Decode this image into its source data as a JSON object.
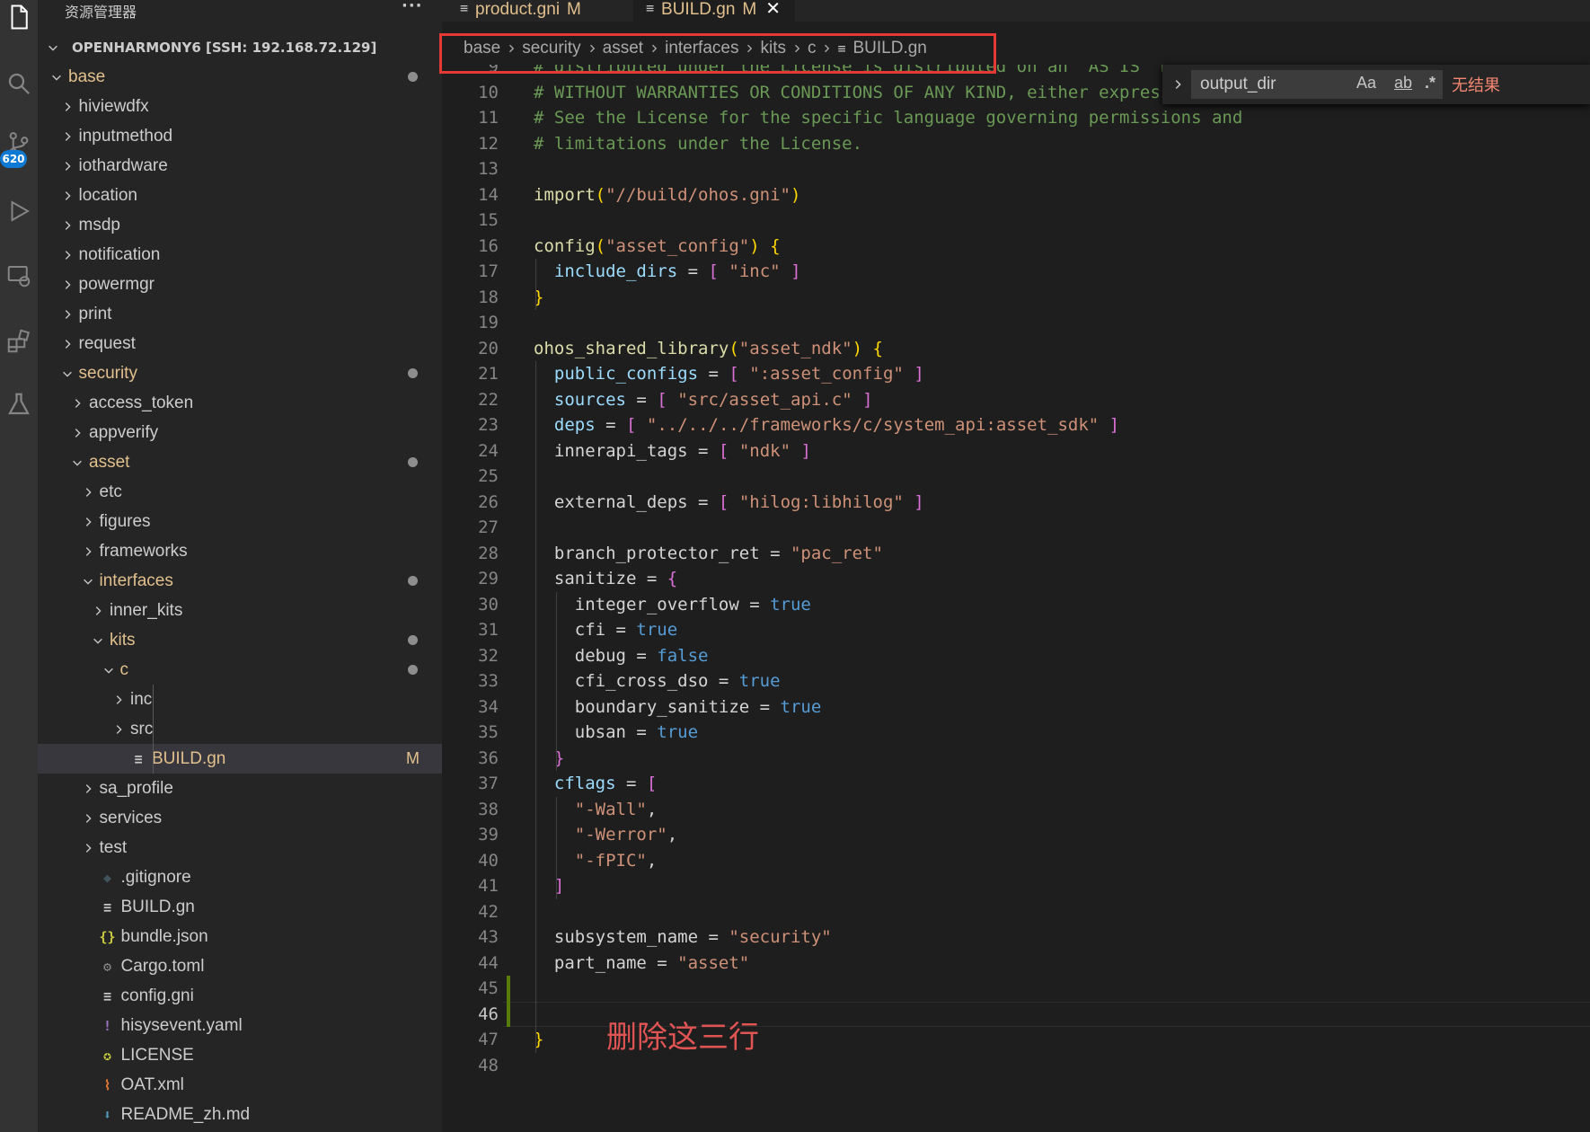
{
  "activity_bar": {
    "items": [
      {
        "name": "explorer-icon",
        "active": true
      },
      {
        "name": "search-icon"
      },
      {
        "name": "source-control-icon",
        "badge": "620"
      },
      {
        "name": "run-debug-icon"
      },
      {
        "name": "remote-explorer-icon"
      },
      {
        "name": "extensions-icon"
      },
      {
        "name": "testing-icon"
      }
    ]
  },
  "sidebar": {
    "title": "资源管理器",
    "more": "···",
    "root": "OPENHARMONY6 [SSH: 192.168.72.129]",
    "tree": [
      {
        "label": "base",
        "level": 0,
        "expanded": true,
        "modified": true,
        "dot": true
      },
      {
        "label": "hiviewdfx",
        "level": 1,
        "folder": true
      },
      {
        "label": "inputmethod",
        "level": 1,
        "folder": true
      },
      {
        "label": "iothardware",
        "level": 1,
        "folder": true
      },
      {
        "label": "location",
        "level": 1,
        "folder": true
      },
      {
        "label": "msdp",
        "level": 1,
        "folder": true
      },
      {
        "label": "notification",
        "level": 1,
        "folder": true
      },
      {
        "label": "powermgr",
        "level": 1,
        "folder": true
      },
      {
        "label": "print",
        "level": 1,
        "folder": true
      },
      {
        "label": "request",
        "level": 1,
        "folder": true
      },
      {
        "label": "security",
        "level": 1,
        "expanded": true,
        "modified": true,
        "dot": true
      },
      {
        "label": "access_token",
        "level": 2,
        "folder": true
      },
      {
        "label": "appverify",
        "level": 2,
        "folder": true
      },
      {
        "label": "asset",
        "level": 2,
        "expanded": true,
        "modified": true,
        "dot": true
      },
      {
        "label": "etc",
        "level": 3,
        "folder": true
      },
      {
        "label": "figures",
        "level": 3,
        "folder": true
      },
      {
        "label": "frameworks",
        "level": 3,
        "folder": true
      },
      {
        "label": "interfaces",
        "level": 3,
        "expanded": true,
        "modified": true,
        "dot": true
      },
      {
        "label": "inner_kits",
        "level": 4,
        "folder": true
      },
      {
        "label": "kits",
        "level": 4,
        "expanded": true,
        "modified": true,
        "dot": true
      },
      {
        "label": "c",
        "level": 5,
        "expanded": true,
        "modified": true,
        "dot": true
      },
      {
        "label": "inc",
        "level": 6,
        "folder": true
      },
      {
        "label": "src",
        "level": 6,
        "folder": true
      },
      {
        "label": "BUILD.gn",
        "level": 6,
        "file_icon": "≡",
        "icon_color": "#c5c5c5",
        "modified": true,
        "flag": "M",
        "selected": true
      },
      {
        "label": "sa_profile",
        "level": 3,
        "folder": true
      },
      {
        "label": "services",
        "level": 3,
        "folder": true
      },
      {
        "label": "test",
        "level": 3,
        "folder": true
      },
      {
        "label": ".gitignore",
        "level": 3,
        "file_icon": "◆",
        "icon_color": "#41535b"
      },
      {
        "label": "BUILD.gn",
        "level": 3,
        "file_icon": "≡",
        "icon_color": "#c5c5c5"
      },
      {
        "label": "bundle.json",
        "level": 3,
        "file_icon": "{}",
        "icon_color": "#cbcb41"
      },
      {
        "label": "Cargo.toml",
        "level": 3,
        "file_icon": "⚙",
        "icon_color": "#8c8c8c"
      },
      {
        "label": "config.gni",
        "level": 3,
        "file_icon": "≡",
        "icon_color": "#c5c5c5"
      },
      {
        "label": "hisysevent.yaml",
        "level": 3,
        "file_icon": "!",
        "icon_color": "#a074c4"
      },
      {
        "label": "LICENSE",
        "level": 3,
        "file_icon": "✪",
        "icon_color": "#cbcb41"
      },
      {
        "label": "OAT.xml",
        "level": 3,
        "file_icon": "⌇",
        "icon_color": "#e37933"
      },
      {
        "label": "README_zh.md",
        "level": 3,
        "file_icon": "⬇",
        "icon_color": "#519aba"
      }
    ]
  },
  "tabs": [
    {
      "label": "product.gni",
      "flag": "M",
      "active": false
    },
    {
      "label": "BUILD.gn",
      "flag": "M",
      "active": true,
      "close": "✕"
    }
  ],
  "breadcrumb": [
    "base",
    "security",
    "asset",
    "interfaces",
    "kits",
    "c",
    "BUILD.gn"
  ],
  "find_widget": {
    "value": "output_dir",
    "match_case": "Aa",
    "whole_word": "ab",
    "regex": ".*",
    "result": "无结果"
  },
  "editor": {
    "annotation": "删除这三行",
    "lines": [
      {
        "n": "9",
        "tokens": [
          [
            "cm",
            "# distributed under the License is distributed on an \"AS IS\" BASIS,"
          ]
        ]
      },
      {
        "n": "10",
        "tokens": [
          [
            "cm",
            "# WITHOUT WARRANTIES OR CONDITIONS OF ANY KIND, either express or implied."
          ]
        ]
      },
      {
        "n": "11",
        "tokens": [
          [
            "cm",
            "# See the License for the specific language governing permissions and"
          ]
        ]
      },
      {
        "n": "12",
        "tokens": [
          [
            "cm",
            "# limitations under the License."
          ]
        ]
      },
      {
        "n": "13",
        "tokens": []
      },
      {
        "n": "14",
        "tokens": [
          [
            "fn",
            "import"
          ],
          [
            "br1",
            "("
          ],
          [
            "str",
            "\"//build/ohos.gni\""
          ],
          [
            "br1",
            ")"
          ]
        ]
      },
      {
        "n": "15",
        "tokens": []
      },
      {
        "n": "16",
        "tokens": [
          [
            "fn",
            "config"
          ],
          [
            "br1",
            "("
          ],
          [
            "str",
            "\"asset_config\""
          ],
          [
            "br1",
            ")"
          ],
          [
            "op",
            " "
          ],
          [
            "br1",
            "{"
          ]
        ]
      },
      {
        "n": "17",
        "tokens": [
          [
            "op",
            "  "
          ],
          [
            "var",
            "include_dirs"
          ],
          [
            "op",
            " = "
          ],
          [
            "br2",
            "["
          ],
          [
            "op",
            " "
          ],
          [
            "str",
            "\"inc\""
          ],
          [
            "op",
            " "
          ],
          [
            "br2",
            "]"
          ]
        ]
      },
      {
        "n": "18",
        "tokens": [
          [
            "br1",
            "}"
          ]
        ]
      },
      {
        "n": "19",
        "tokens": []
      },
      {
        "n": "20",
        "tokens": [
          [
            "fn",
            "ohos_shared_library"
          ],
          [
            "br1",
            "("
          ],
          [
            "str",
            "\"asset_ndk\""
          ],
          [
            "br1",
            ")"
          ],
          [
            "op",
            " "
          ],
          [
            "br1",
            "{"
          ]
        ]
      },
      {
        "n": "21",
        "tokens": [
          [
            "op",
            "  "
          ],
          [
            "var",
            "public_configs"
          ],
          [
            "op",
            " = "
          ],
          [
            "br2",
            "["
          ],
          [
            "op",
            " "
          ],
          [
            "str",
            "\":asset_config\""
          ],
          [
            "op",
            " "
          ],
          [
            "br2",
            "]"
          ]
        ]
      },
      {
        "n": "22",
        "tokens": [
          [
            "op",
            "  "
          ],
          [
            "var",
            "sources"
          ],
          [
            "op",
            " = "
          ],
          [
            "br2",
            "["
          ],
          [
            "op",
            " "
          ],
          [
            "str",
            "\"src/asset_api.c\""
          ],
          [
            "op",
            " "
          ],
          [
            "br2",
            "]"
          ]
        ]
      },
      {
        "n": "23",
        "tokens": [
          [
            "op",
            "  "
          ],
          [
            "var",
            "deps"
          ],
          [
            "op",
            " = "
          ],
          [
            "br2",
            "["
          ],
          [
            "op",
            " "
          ],
          [
            "str",
            "\"../../../frameworks/c/system_api:asset_sdk\""
          ],
          [
            "op",
            " "
          ],
          [
            "br2",
            "]"
          ]
        ]
      },
      {
        "n": "24",
        "tokens": [
          [
            "op",
            "  innerapi_tags = "
          ],
          [
            "br2",
            "["
          ],
          [
            "op",
            " "
          ],
          [
            "str",
            "\"ndk\""
          ],
          [
            "op",
            " "
          ],
          [
            "br2",
            "]"
          ]
        ]
      },
      {
        "n": "25",
        "tokens": []
      },
      {
        "n": "26",
        "tokens": [
          [
            "op",
            "  external_deps = "
          ],
          [
            "br2",
            "["
          ],
          [
            "op",
            " "
          ],
          [
            "str",
            "\"hilog:libhilog\""
          ],
          [
            "op",
            " "
          ],
          [
            "br2",
            "]"
          ]
        ]
      },
      {
        "n": "27",
        "tokens": []
      },
      {
        "n": "28",
        "tokens": [
          [
            "op",
            "  branch_protector_ret = "
          ],
          [
            "str",
            "\"pac_ret\""
          ]
        ]
      },
      {
        "n": "29",
        "tokens": [
          [
            "op",
            "  sanitize = "
          ],
          [
            "br2",
            "{"
          ]
        ]
      },
      {
        "n": "30",
        "tokens": [
          [
            "op",
            "    integer_overflow = "
          ],
          [
            "kw",
            "true"
          ]
        ]
      },
      {
        "n": "31",
        "tokens": [
          [
            "op",
            "    cfi = "
          ],
          [
            "kw",
            "true"
          ]
        ]
      },
      {
        "n": "32",
        "tokens": [
          [
            "op",
            "    debug = "
          ],
          [
            "kw",
            "false"
          ]
        ]
      },
      {
        "n": "33",
        "tokens": [
          [
            "op",
            "    cfi_cross_dso = "
          ],
          [
            "kw",
            "true"
          ]
        ]
      },
      {
        "n": "34",
        "tokens": [
          [
            "op",
            "    boundary_sanitize = "
          ],
          [
            "kw",
            "true"
          ]
        ]
      },
      {
        "n": "35",
        "tokens": [
          [
            "op",
            "    ubsan = "
          ],
          [
            "kw",
            "true"
          ]
        ]
      },
      {
        "n": "36",
        "tokens": [
          [
            "op",
            "  "
          ],
          [
            "br2",
            "}"
          ]
        ]
      },
      {
        "n": "37",
        "tokens": [
          [
            "op",
            "  "
          ],
          [
            "var",
            "cflags"
          ],
          [
            "op",
            " = "
          ],
          [
            "br2",
            "["
          ]
        ]
      },
      {
        "n": "38",
        "tokens": [
          [
            "op",
            "    "
          ],
          [
            "str",
            "\"-Wall\""
          ],
          [
            "op",
            ","
          ]
        ]
      },
      {
        "n": "39",
        "tokens": [
          [
            "op",
            "    "
          ],
          [
            "str",
            "\"-Werror\""
          ],
          [
            "op",
            ","
          ]
        ]
      },
      {
        "n": "40",
        "tokens": [
          [
            "op",
            "    "
          ],
          [
            "str",
            "\"-fPIC\""
          ],
          [
            "op",
            ","
          ]
        ]
      },
      {
        "n": "41",
        "tokens": [
          [
            "op",
            "  "
          ],
          [
            "br2",
            "]"
          ]
        ]
      },
      {
        "n": "42",
        "tokens": []
      },
      {
        "n": "43",
        "tokens": [
          [
            "op",
            "  subsystem_name = "
          ],
          [
            "str",
            "\"security\""
          ]
        ]
      },
      {
        "n": "44",
        "tokens": [
          [
            "op",
            "  part_name = "
          ],
          [
            "str",
            "\"asset\""
          ]
        ]
      },
      {
        "n": "45",
        "tokens": []
      },
      {
        "n": "46",
        "tokens": [],
        "current": true
      },
      {
        "n": "47",
        "tokens": [
          [
            "br1",
            "}"
          ]
        ]
      },
      {
        "n": "48",
        "tokens": []
      }
    ]
  }
}
